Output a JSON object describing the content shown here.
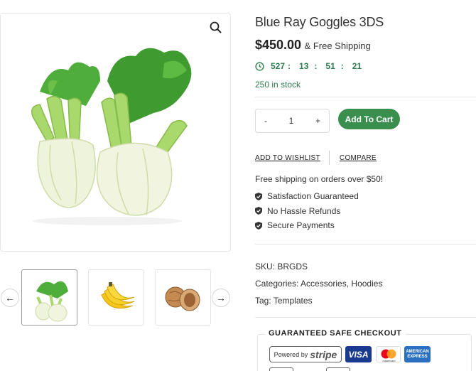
{
  "product": {
    "title": "Blue Ray Goggles 3DS",
    "price": "$450.00",
    "shipping_suffix": "& Free Shipping",
    "stock": "250 in stock"
  },
  "countdown": {
    "days": "527",
    "hours": "13",
    "minutes": "51",
    "seconds": "21",
    "sep1": ":",
    "sep2": ":",
    "sep3": ":"
  },
  "quantity": {
    "minus": "-",
    "value": "1",
    "plus": "+"
  },
  "buttons": {
    "add_to_cart": "Add To Cart",
    "wishlist": "ADD TO WISHLIST",
    "compare": "COMPARE"
  },
  "shipping_note": "Free shipping on orders over $50!",
  "features": [
    "Satisfaction Guaranteed",
    "No Hassle Refunds",
    "Secure Payments"
  ],
  "meta": {
    "sku_label": "SKU:",
    "sku": "BRGDS",
    "categories_label": "Categories:",
    "category_1": "Accessories",
    "category_sep": ",",
    "category_2": "Hoodies",
    "tag_label": "Tag:",
    "tag": "Templates"
  },
  "checkout": {
    "title": "GUARANTEED SAFE CHECKOUT",
    "stripe_prefix": "Powered by",
    "stripe_name": "stripe",
    "visa": "VISA",
    "mastercard": "mastercard",
    "amex_line1": "AMERICAN",
    "amex_line2": "EXPRESS"
  },
  "gallery": {
    "thumbnails": [
      "fennel",
      "banana",
      "walnut"
    ],
    "active_index": 0
  },
  "colors": {
    "accent": "#3a8f4f",
    "accent_text": "#2e7d4f",
    "border": "#e5e5e5"
  },
  "icons": {
    "zoom": "magnifier-icon",
    "prev": "arrow-left-icon",
    "next": "arrow-right-icon",
    "timer": "clock-icon",
    "feature": "shield-check-icon"
  }
}
